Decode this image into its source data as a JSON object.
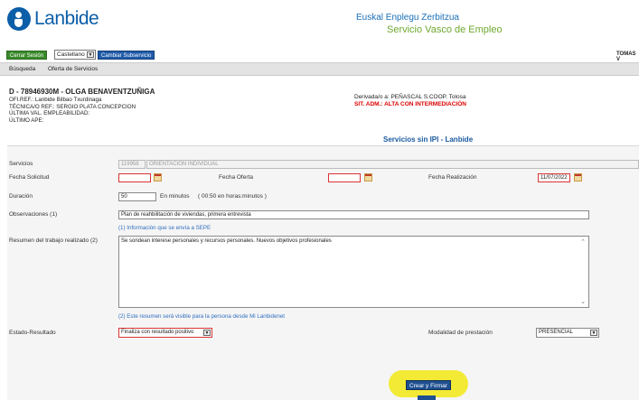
{
  "header": {
    "logo_text": "Lanbide",
    "brand_eu": "Euskal Enplegu Zerbitzua",
    "brand_es": "Servicio Vasco de Empleo"
  },
  "toolbar": {
    "close_session": "Cerrar Sesión",
    "language": "Castellano",
    "change_subservice": "Cambiar Subservicio",
    "user": "TOMAS V"
  },
  "nav": {
    "items": [
      "Búsqueda",
      "Oferta de Servicios"
    ]
  },
  "person": {
    "title": "D - 78946930M - OLGA BENAVENTZUÑIGA",
    "lines": [
      "OFI.REF.: Lanbide Bilbao Txurdinaga",
      "TÉCNICA/O REF.: SERGIO PLATA CONCEPCION",
      "ÚLTIMA VAL. EMPLEABILIDAD:",
      "ÚLTIMO APE:"
    ],
    "derived": "Derivada/o a: PEÑASCAL S.COOP. Tolosa",
    "status": "SIT. ADM.: ALTA CON INTERMEDIACIÓN"
  },
  "section_title": "Servicios sin IPI - Lanbide",
  "form": {
    "servicios_label": "Servicios",
    "servicio_code": "119958",
    "servicio_name": "ORIENTACIÓN INDIVIDUAL",
    "fecha_solicitud_label": "Fecha Solicitud",
    "fecha_solicitud": "",
    "fecha_oferta_label": "Fecha Oferta",
    "fecha_oferta": "",
    "fecha_realizacion_label": "Fecha Realización",
    "fecha_realizacion": "11/07/2022",
    "duracion_label": "Duración",
    "duracion": "50",
    "duracion_unit": "En minutos",
    "duracion_hint": "( 00:50 en horas:minutos )",
    "observaciones_label": "Observaciones (1)",
    "observaciones": "Plan de reahbilitación de viviendas, primera entrevista",
    "sepe_note": "(1) Información que se envía a SEPE",
    "resumen_label": "Resumen del trabajo realizado (2)",
    "resumen": "Se sondean interese personales y recursos personales. Nuevos objetivos profesionales",
    "resumen_note": "(2) Este resumen será visible para la persona desde Mi Lanbidenet",
    "estado_label": "Estado-Resultado",
    "estado": "Finaliza con resultado positivo",
    "modalidad_label": "Modalidad de prestación",
    "modalidad": "PRESENCIAL",
    "submit": "Crear y Firmar"
  },
  "colors": {
    "brand_blue": "#0b5ea8",
    "brand_green": "#6fa82f",
    "highlight": "#f2ea35",
    "error_red": "#d00000"
  }
}
